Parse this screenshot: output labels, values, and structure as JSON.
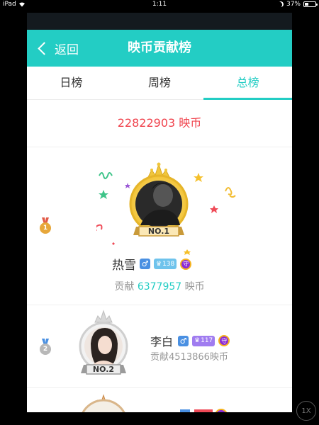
{
  "status_bar": {
    "device": "iPad",
    "time": "1:11",
    "battery": "37%",
    "battery_level": 0.37
  },
  "nav": {
    "back_label": "返回",
    "title": "映币贡献榜"
  },
  "tabs": [
    {
      "label": "日榜",
      "active": false
    },
    {
      "label": "周榜",
      "active": false
    },
    {
      "label": "总榜",
      "active": true
    }
  ],
  "total": {
    "text": "22822903 映币"
  },
  "ranking": [
    {
      "rank": "1",
      "badge": "NO.1",
      "name": "热雪",
      "gender": "♂",
      "level": "138",
      "guard": "守",
      "contrib_label": "贡献",
      "contrib_value": "6377957",
      "contrib_unit": "映币"
    },
    {
      "rank": "2",
      "badge": "NO.2",
      "name": "李白",
      "gender": "♂",
      "level": "117",
      "guard": "守",
      "contrib_text": "贡献4513866映币"
    }
  ],
  "colors": {
    "accent": "#23cdc4",
    "total": "#f0434d",
    "gold": "#f2c233",
    "silver": "#c9c9c9"
  },
  "overlay": {
    "speed": "1X"
  }
}
